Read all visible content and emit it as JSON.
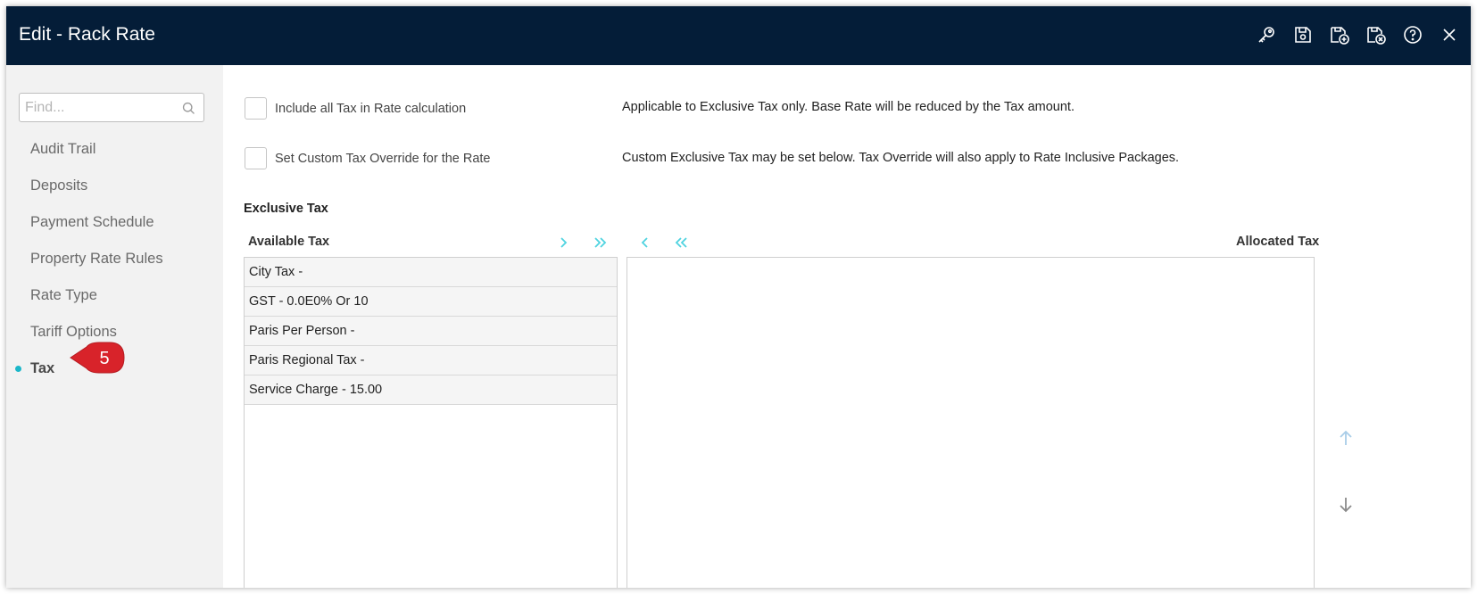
{
  "window": {
    "title": "Edit - Rack Rate",
    "toolbar_icons": [
      "key-icon",
      "save-icon",
      "save-add-icon",
      "save-close-icon",
      "help-icon",
      "close-icon"
    ]
  },
  "sidebar": {
    "search_placeholder": "Find...",
    "items": [
      {
        "label": "Audit Trail",
        "active": false
      },
      {
        "label": "Deposits",
        "active": false
      },
      {
        "label": "Payment Schedule",
        "active": false
      },
      {
        "label": "Property Rate Rules",
        "active": false
      },
      {
        "label": "Rate Type",
        "active": false
      },
      {
        "label": "Tariff Options",
        "active": false
      },
      {
        "label": "Tax",
        "active": true
      }
    ],
    "callout_number": "5",
    "active_dot_color": "#1bb7c9",
    "callout_color": "#d8232a"
  },
  "main": {
    "include_tax": {
      "label": "Include all Tax in Rate calculation",
      "description": "Applicable to Exclusive Tax only. Base Rate will be reduced by the Tax amount."
    },
    "custom_override": {
      "label": "Set Custom Tax Override for the Rate",
      "description": "Custom Exclusive Tax may be set below. Tax Override will also apply to Rate Inclusive Packages."
    },
    "section_title": "Exclusive Tax",
    "available_header": "Available Tax",
    "allocated_header": "Allocated Tax",
    "available_items": [
      "City Tax -",
      "GST - 0.0E0% Or 10",
      "Paris Per Person -",
      "Paris Regional Tax -",
      "Service Charge - 15.00"
    ],
    "allocated_items": []
  },
  "colors": {
    "titlebar": "#041d38",
    "accent": "#4fd3e0"
  }
}
